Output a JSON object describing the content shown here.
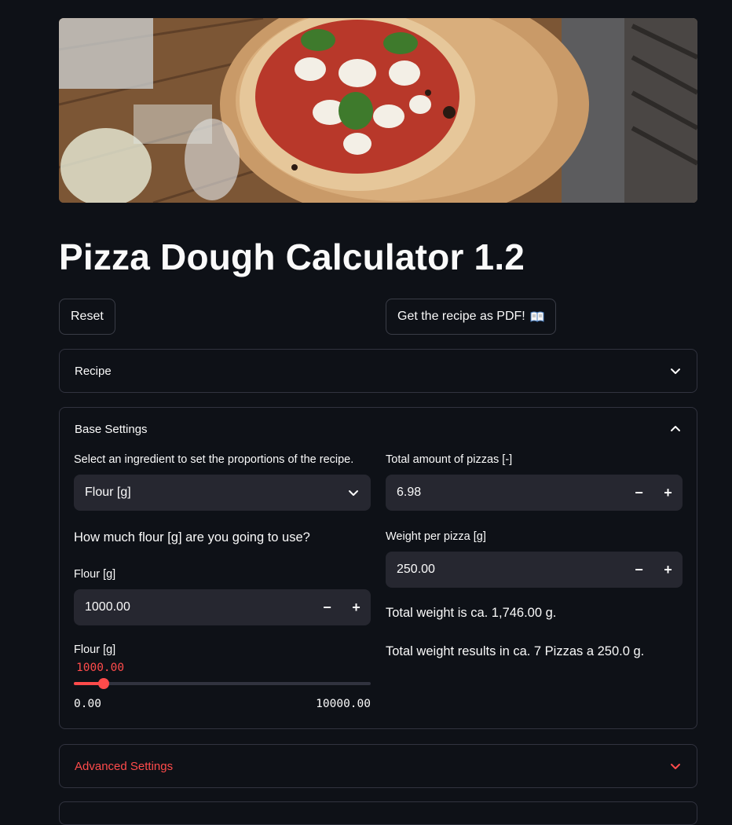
{
  "app": {
    "title": "Pizza Dough Calculator 1.2"
  },
  "hero_image": {
    "description_icon": "pizza-photo"
  },
  "actions": {
    "reset_label": "Reset",
    "pdf_label": "Get the recipe as PDF!",
    "pdf_icon": "open-book-icon"
  },
  "expanders": {
    "recipe": {
      "label": "Recipe",
      "expanded": false
    },
    "base": {
      "label": "Base Settings",
      "expanded": true
    },
    "advanced": {
      "label": "Advanced Settings",
      "expanded": false
    }
  },
  "base_settings": {
    "ingredient_select": {
      "label": "Select an ingredient to set the proportions of the recipe.",
      "value": "Flour [g]"
    },
    "question": "How much flour [g] are you going to use?",
    "flour_input": {
      "label": "Flour [g]",
      "value": "1000.00"
    },
    "flour_slider": {
      "label": "Flour [g]",
      "value_label": "1000.00",
      "min_label": "0.00",
      "max_label": "10000.00",
      "value": 1000,
      "min": 0,
      "max": 10000
    },
    "total_pizzas": {
      "label": "Total amount of pizzas [-]",
      "value": "6.98"
    },
    "weight_per_pizza": {
      "label": "Weight per pizza [g]",
      "value": "250.00"
    },
    "total_weight_text": "Total weight is ca. 1,746.00 g.",
    "result_text": "Total weight results in ca. 7 Pizzas a 250.0 g."
  },
  "stepper": {
    "minus": "−",
    "plus": "+"
  },
  "colors": {
    "background": "#0e1117",
    "widget": "#262730",
    "accent": "#ff4b4b",
    "border": "#31333f"
  }
}
